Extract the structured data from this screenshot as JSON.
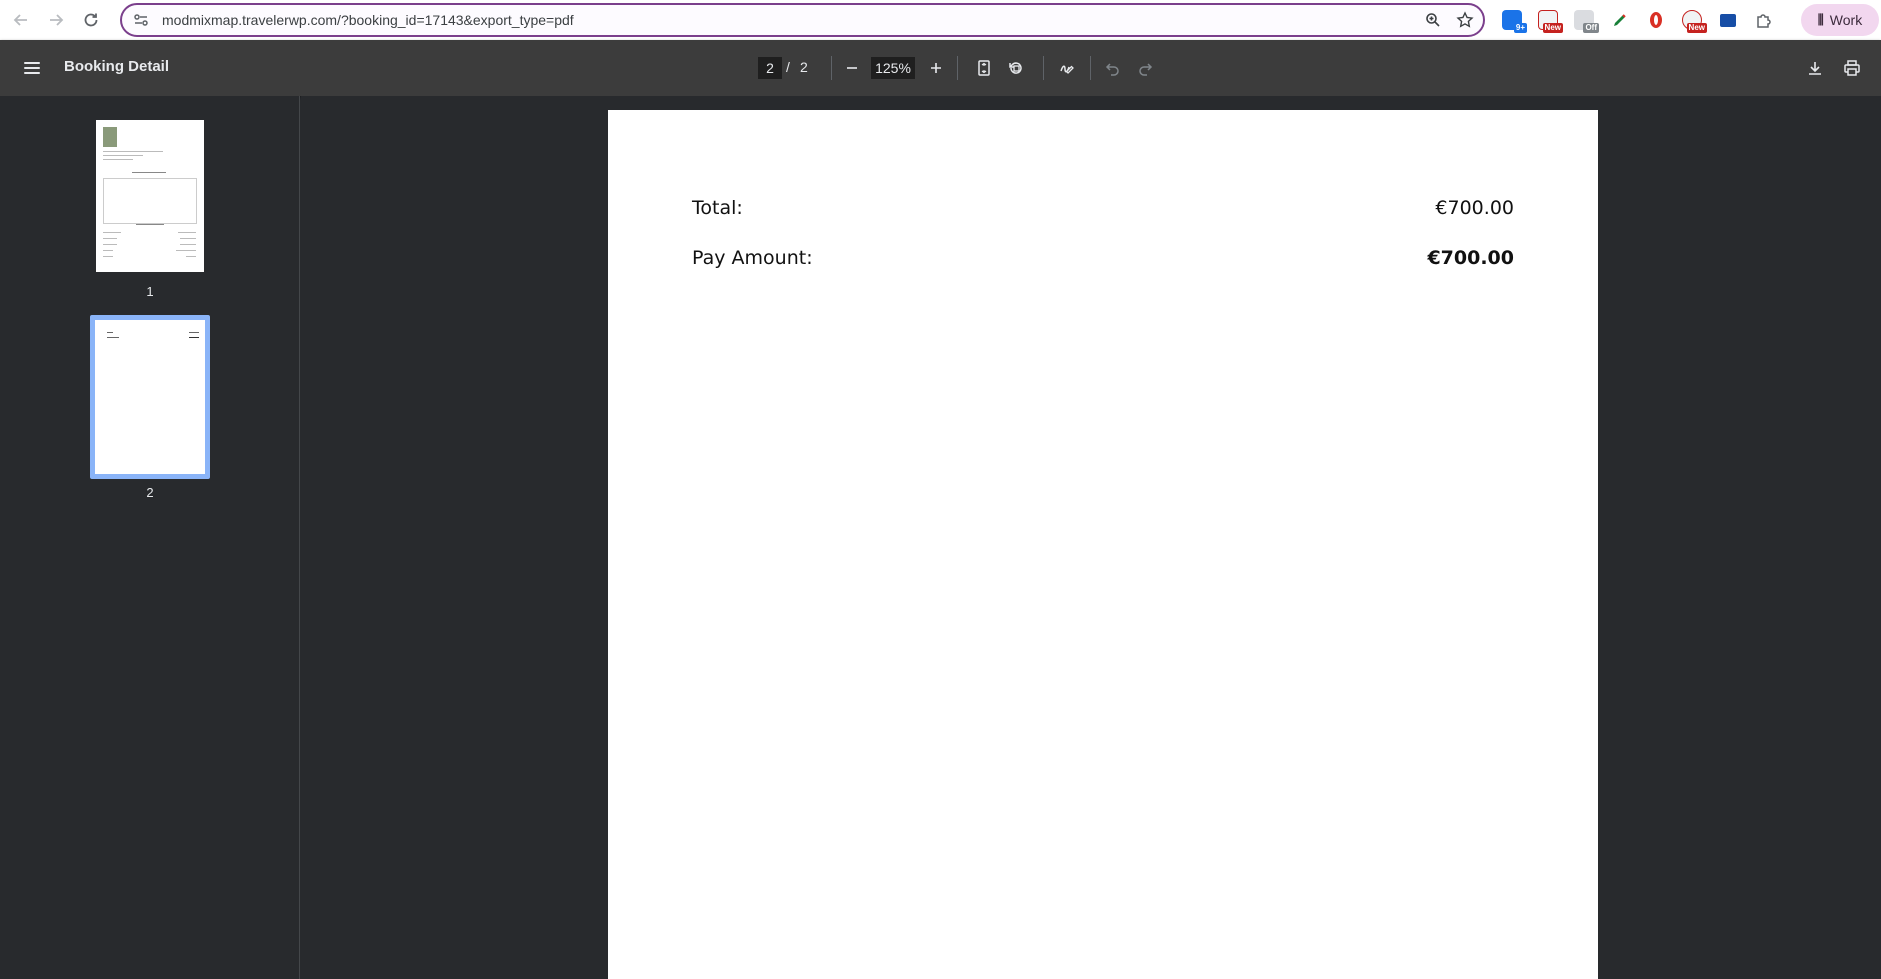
{
  "browser": {
    "url": "modmixmap.travelerwp.com/?booking_id=17143&export_type=pdf",
    "profile_label": "Work",
    "extensions": [
      {
        "name": "ext-grammar-icon",
        "color": "#1a73e8",
        "badge": "9+"
      },
      {
        "name": "ext-news-icon",
        "color": "#c5221f",
        "badge": "New"
      },
      {
        "name": "ext-off-icon",
        "color": "#9aa0a6",
        "badge": "Off"
      },
      {
        "name": "ext-pen-icon",
        "color": "#188038",
        "badge": ""
      },
      {
        "name": "ext-opera-icon",
        "color": "#d93025",
        "badge": ""
      },
      {
        "name": "ext-new-icon",
        "color": "#c5221f",
        "badge": "New"
      },
      {
        "name": "ext-camera-icon",
        "color": "#174ea6",
        "badge": ""
      }
    ]
  },
  "pdf": {
    "title": "Booking Detail",
    "current_page": "2",
    "page_separator": "/",
    "total_pages": "2",
    "zoom": "125%",
    "thumbnails": [
      {
        "label": "1"
      },
      {
        "label": "2"
      }
    ]
  },
  "document": {
    "total_label": "Total:",
    "total_value": "€700.00",
    "pay_label": "Pay Amount:",
    "pay_value": "€700.00"
  }
}
